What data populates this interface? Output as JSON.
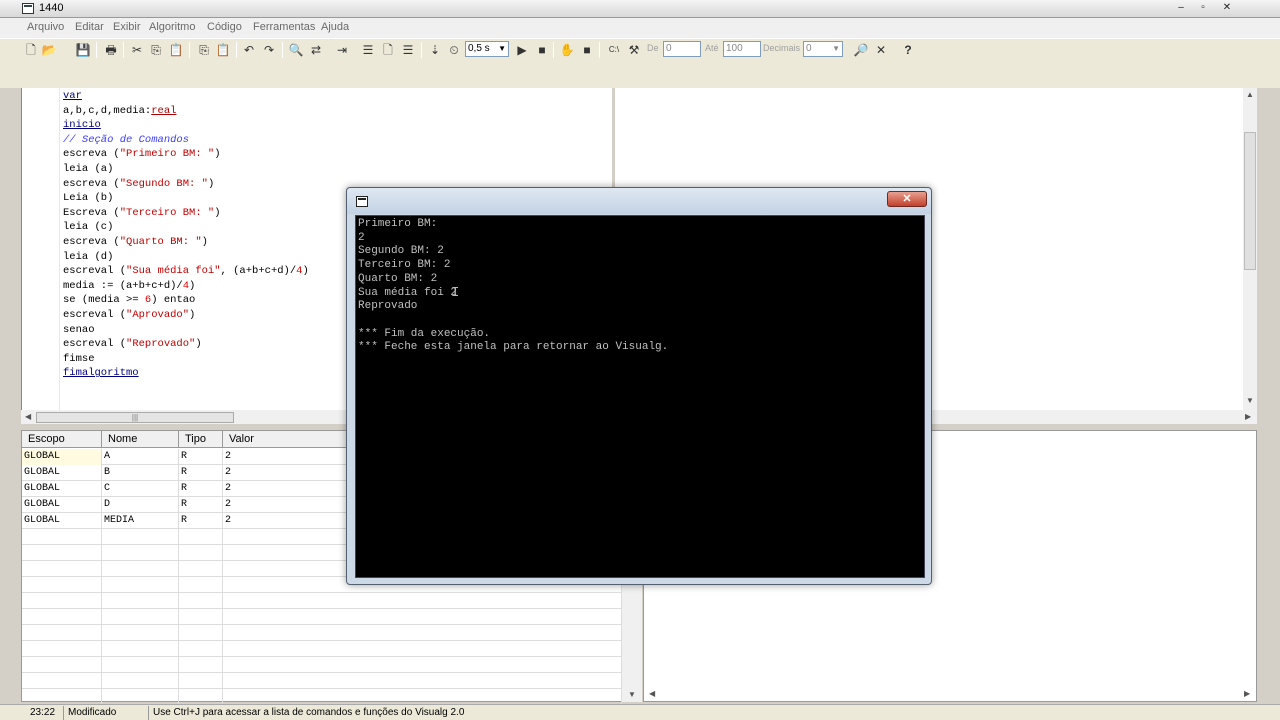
{
  "window": {
    "title": "1440",
    "min": "–",
    "restore": "▫",
    "close": "✕"
  },
  "menu": [
    "Arquivo",
    "Editar",
    "Exibir",
    "Algoritmo",
    "Código",
    "Ferramentas",
    "Ajuda"
  ],
  "toolbar": {
    "speed_value": "0,5 s",
    "de_label": "De",
    "de_value": "0",
    "ate_label": "Até",
    "ate_value": "100",
    "decimais_label": "Decimais",
    "decimais_value": "0",
    "icons": {
      "new": "🗋",
      "open": "📂",
      "save": "💾",
      "print": "🖶",
      "cut": "✂",
      "copy": "⎘",
      "paste": "📋",
      "undo": "↶",
      "redo": "↷",
      "find": "🔍",
      "replace": "⇄",
      "indent": "⇥",
      "list": "☰",
      "timer": "⏲",
      "run": "▶",
      "step": "⇣",
      "hand": "✋",
      "stop": "■",
      "cmd": "C:\\",
      "tool": "⚒",
      "zoom": "🔎",
      "help": "?"
    }
  },
  "code_lines": [
    {
      "parts": [
        {
          "t": "var",
          "c": "kw"
        }
      ]
    },
    {
      "parts": [
        {
          "t": "a,b,c,d,media:",
          "c": ""
        },
        {
          "t": "real",
          "c": "ty"
        }
      ]
    },
    {
      "parts": [
        {
          "t": "inicio",
          "c": "kw"
        }
      ]
    },
    {
      "parts": [
        {
          "t": "// Seção de Comandos",
          "c": "cm"
        }
      ]
    },
    {
      "parts": [
        {
          "t": "escreva (",
          "c": ""
        },
        {
          "t": "\"Primeiro BM: \"",
          "c": "st"
        },
        {
          "t": ")",
          "c": ""
        }
      ]
    },
    {
      "parts": [
        {
          "t": "leia (a)",
          "c": ""
        }
      ]
    },
    {
      "parts": [
        {
          "t": "escreva (",
          "c": ""
        },
        {
          "t": "\"Segundo BM: \"",
          "c": "st"
        },
        {
          "t": ")",
          "c": ""
        }
      ]
    },
    {
      "parts": [
        {
          "t": "Leia (b)",
          "c": ""
        }
      ]
    },
    {
      "parts": [
        {
          "t": "Escreva (",
          "c": ""
        },
        {
          "t": "\"Terceiro BM: \"",
          "c": "st"
        },
        {
          "t": ")",
          "c": ""
        }
      ]
    },
    {
      "parts": [
        {
          "t": "leia (c)",
          "c": ""
        }
      ]
    },
    {
      "parts": [
        {
          "t": "escreva (",
          "c": ""
        },
        {
          "t": "\"Quarto BM: \"",
          "c": "st"
        },
        {
          "t": ")",
          "c": ""
        }
      ]
    },
    {
      "parts": [
        {
          "t": "leia (d)",
          "c": ""
        }
      ]
    },
    {
      "parts": [
        {
          "t": "escreval (",
          "c": ""
        },
        {
          "t": "\"Sua média foi\"",
          "c": "st"
        },
        {
          "t": ", (a+b+c+d)/",
          "c": ""
        },
        {
          "t": "4",
          "c": "nm"
        },
        {
          "t": ")",
          "c": ""
        }
      ]
    },
    {
      "parts": [
        {
          "t": "media := (a+b+c+d)/",
          "c": ""
        },
        {
          "t": "4",
          "c": "nm"
        },
        {
          "t": ")",
          "c": ""
        }
      ]
    },
    {
      "parts": [
        {
          "t": "se (media >= ",
          "c": ""
        },
        {
          "t": "6",
          "c": "nm"
        },
        {
          "t": ") entao",
          "c": ""
        }
      ]
    },
    {
      "parts": [
        {
          "t": "escreval (",
          "c": ""
        },
        {
          "t": "\"Aprovado\"",
          "c": "st"
        },
        {
          "t": ")",
          "c": ""
        }
      ]
    },
    {
      "parts": [
        {
          "t": "senao",
          "c": ""
        }
      ]
    },
    {
      "parts": [
        {
          "t": "escreval (",
          "c": ""
        },
        {
          "t": "\"Reprovado\"",
          "c": "st"
        },
        {
          "t": ")",
          "c": ""
        }
      ]
    },
    {
      "parts": [
        {
          "t": "fimse",
          "c": ""
        }
      ]
    },
    {
      "parts": [
        {
          "t": "fimalgoritmo",
          "c": "kw"
        }
      ]
    }
  ],
  "variables": {
    "headers": [
      "Escopo",
      "Nome",
      "Tipo",
      "Valor"
    ],
    "rows": [
      [
        "GLOBAL",
        "A",
        "R",
        "2"
      ],
      [
        "GLOBAL",
        "B",
        "R",
        "2"
      ],
      [
        "GLOBAL",
        "C",
        "R",
        "2"
      ],
      [
        "GLOBAL",
        "D",
        "R",
        "2"
      ],
      [
        "GLOBAL",
        "MEDIA",
        "R",
        "2"
      ]
    ]
  },
  "console": {
    "close_label": "✕",
    "lines": [
      "Primeiro BM:",
      "2",
      "Segundo BM: 2",
      "Terceiro BM: 2",
      "Quarto BM: 2",
      "Sua média foi 2",
      "Reprovado",
      "",
      "*** Fim da execução.",
      "*** Feche esta janela para retornar ao Visualg."
    ]
  },
  "status": {
    "position": "23:22",
    "state": "Modificado",
    "hint": "Use Ctrl+J para acessar a lista de comandos e funções do Visualg 2.0"
  }
}
